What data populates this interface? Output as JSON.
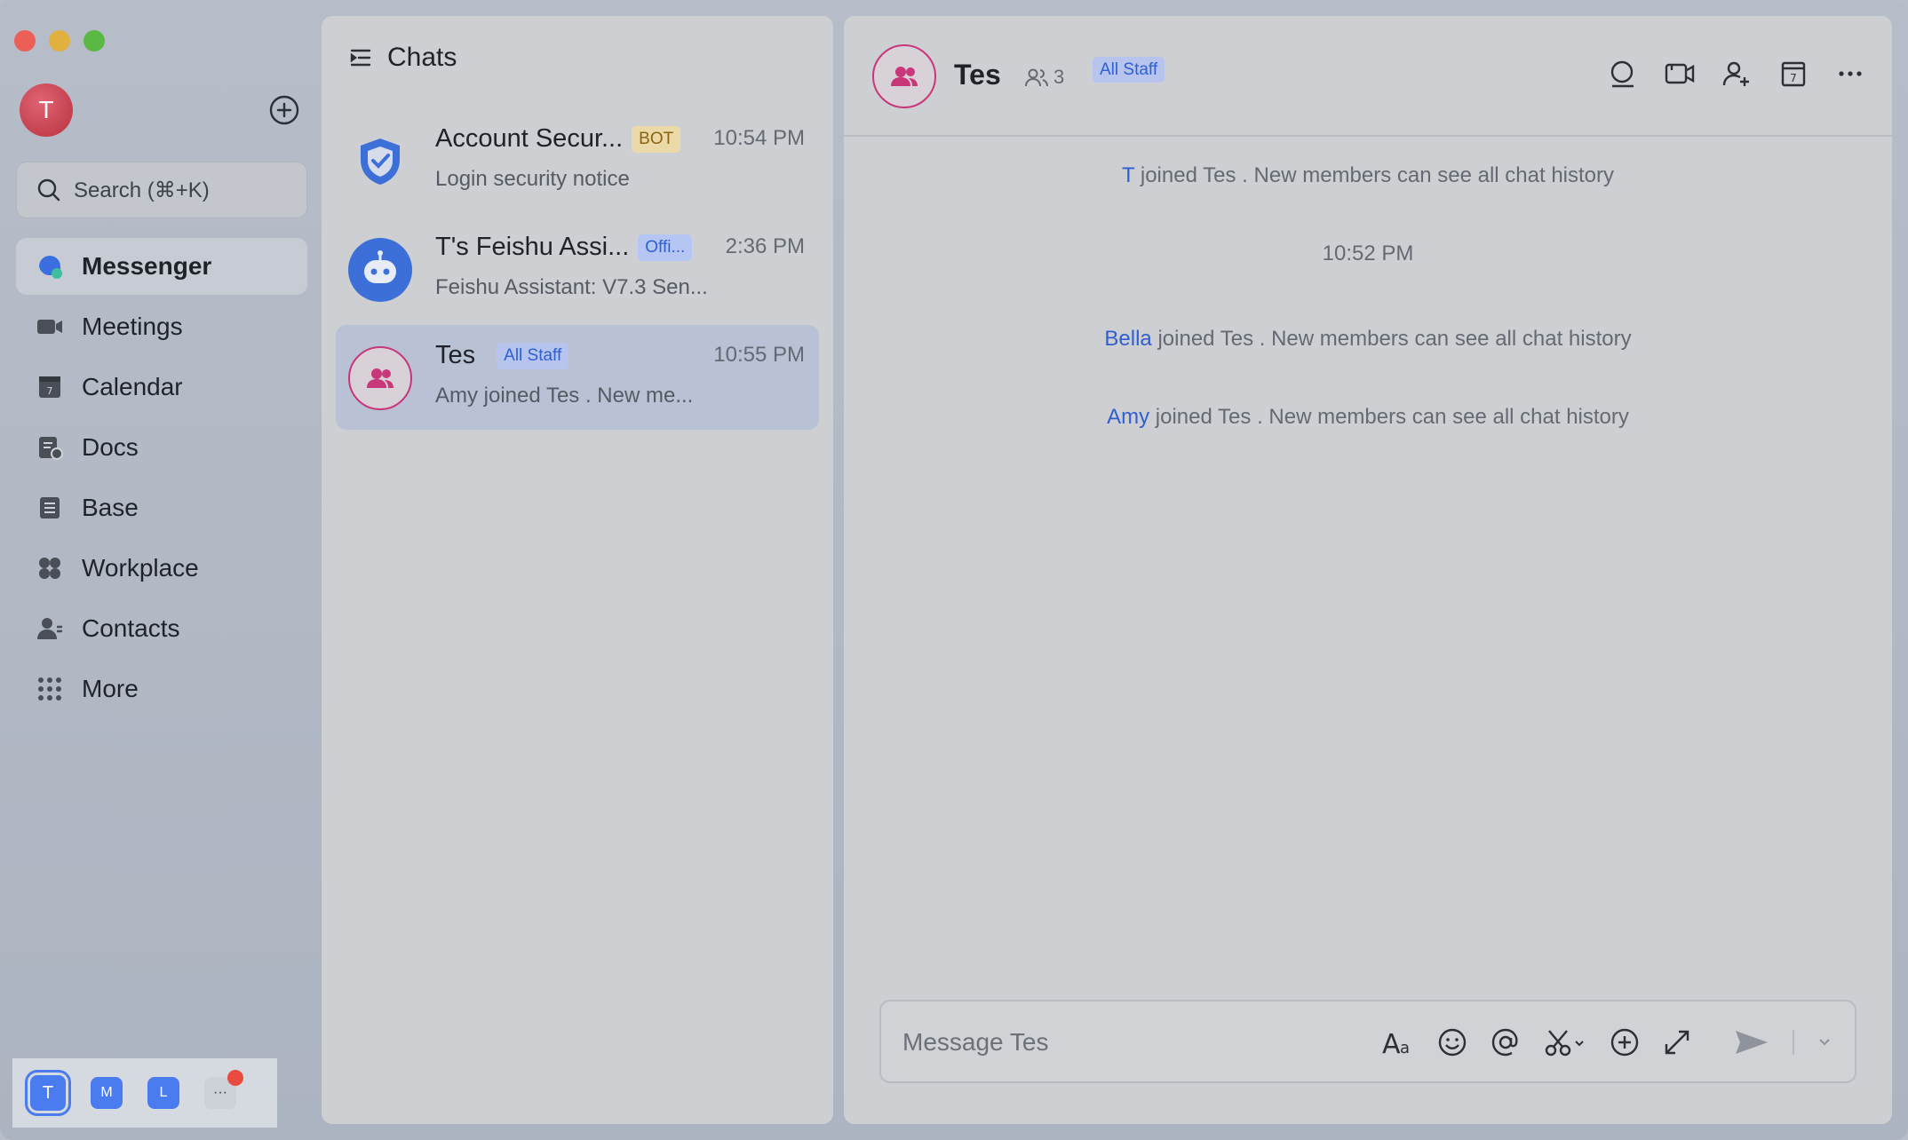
{
  "user": {
    "avatar_initial": "T"
  },
  "search": {
    "placeholder": "Search (⌘+K)"
  },
  "nav": {
    "items": [
      {
        "label": "Messenger",
        "icon": "messenger-icon"
      },
      {
        "label": "Meetings",
        "icon": "video-camera-icon"
      },
      {
        "label": "Calendar",
        "icon": "calendar-icon"
      },
      {
        "label": "Docs",
        "icon": "docs-icon"
      },
      {
        "label": "Base",
        "icon": "base-icon"
      },
      {
        "label": "Workplace",
        "icon": "workplace-icon"
      },
      {
        "label": "Contacts",
        "icon": "contacts-icon"
      },
      {
        "label": "More",
        "icon": "grid-dots-icon"
      }
    ]
  },
  "tenants": [
    "T",
    "M",
    "L",
    "···"
  ],
  "chats": {
    "title": "Chats",
    "items": [
      {
        "name": "Account Secur...",
        "badge": "BOT",
        "time": "10:54 PM",
        "preview": "Login security notice"
      },
      {
        "name": "T's Feishu Assi...",
        "badge": "Offi...",
        "time": "2:36 PM",
        "preview": "Feishu Assistant: V7.3 Sen..."
      },
      {
        "name": "Tes",
        "badge": "All Staff",
        "time": "10:55 PM",
        "preview": "Amy joined Tes . New me..."
      }
    ]
  },
  "conversation": {
    "title": "Tes",
    "member_count": "3",
    "badge": "All Staff",
    "messages": [
      {
        "who": "T",
        "text": "joined Tes . New members can see all chat history"
      },
      {
        "who": "Bella",
        "text": "joined Tes . New members can see all chat history"
      },
      {
        "who": "Amy",
        "text": "joined Tes . New members can see all chat history"
      }
    ],
    "timestamp": "10:52 PM",
    "composer_placeholder": "Message Tes"
  },
  "colors": {
    "accent_blue": "#2f5fd0",
    "group_pink": "#c8377a",
    "badge_red": "#ea4b3f"
  }
}
